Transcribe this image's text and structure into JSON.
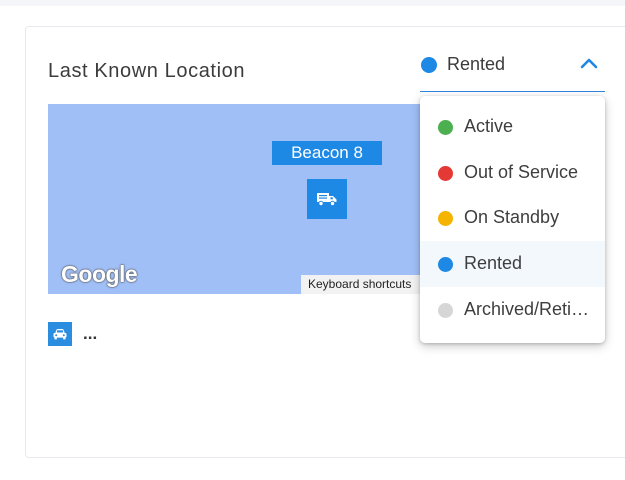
{
  "card": {
    "title": "Last Known Location"
  },
  "status_select": {
    "value": "Rented",
    "color": "#1e88e5",
    "icon": "chevron-up-icon",
    "expanded": true
  },
  "status_options": [
    {
      "label": "Active",
      "color": "#4caf50",
      "selected": false
    },
    {
      "label": "Out of Service",
      "color": "#e53935",
      "selected": false
    },
    {
      "label": "On Standby",
      "color": "#f4b400",
      "selected": false
    },
    {
      "label": "Rented",
      "color": "#1e88e5",
      "selected": true
    },
    {
      "label": "Archived/Retired",
      "color": "#d6d6d6",
      "selected": false
    }
  ],
  "map": {
    "beacon_label": "Beacon 8",
    "marker_icon": "truck-icon",
    "logo_text": "Google",
    "shortcuts_text": "Keyboard shortcuts",
    "background_color": "#a0bff7"
  },
  "vehicle": {
    "icon": "car-icon",
    "name": "..."
  }
}
